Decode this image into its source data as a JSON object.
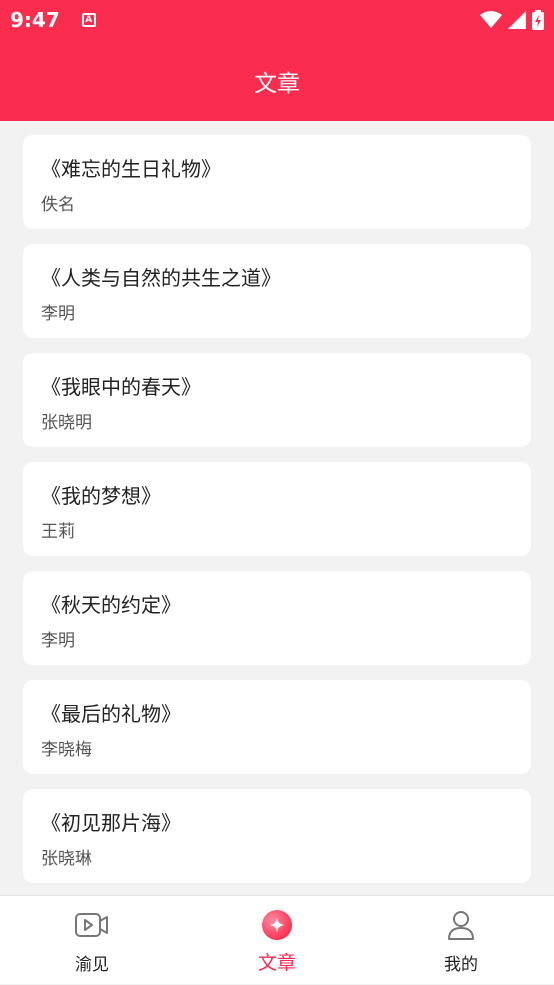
{
  "status_bar": {
    "time": "9:47",
    "notification_icon": "A"
  },
  "header": {
    "title": "文章"
  },
  "articles": [
    {
      "title": "《难忘的生日礼物》",
      "author": "佚名"
    },
    {
      "title": "《人类与自然的共生之道》",
      "author": "李明"
    },
    {
      "title": "《我眼中的春天》",
      "author": "张晓明"
    },
    {
      "title": "《我的梦想》",
      "author": "王莉"
    },
    {
      "title": "《秋天的约定》",
      "author": "李明"
    },
    {
      "title": "《最后的礼物》",
      "author": "李晓梅"
    },
    {
      "title": "《初见那片海》",
      "author": "张晓琳"
    }
  ],
  "tab_bar": {
    "tabs": [
      {
        "label": "渝见",
        "icon": "video-icon",
        "active": false
      },
      {
        "label": "文章",
        "icon": "sparkle-icon",
        "active": true
      },
      {
        "label": "我的",
        "icon": "user-icon",
        "active": false
      }
    ]
  },
  "colors": {
    "accent": "#fa2d4f",
    "background": "#f2f2f2",
    "card": "#ffffff"
  }
}
